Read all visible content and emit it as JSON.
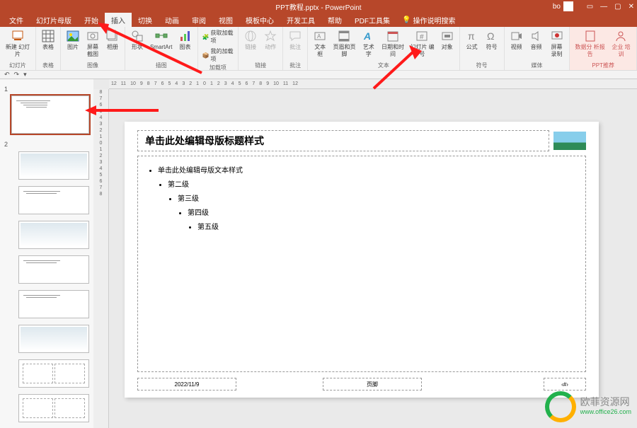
{
  "title": "PPT教程.pptx - PowerPoint",
  "user": "bo",
  "menu": {
    "tabs": [
      "文件",
      "幻灯片母版",
      "开始",
      "插入",
      "切换",
      "动画",
      "审阅",
      "视图",
      "模板中心",
      "开发工具",
      "帮助",
      "PDF工具集"
    ],
    "search_icon_label": "操作说明搜索",
    "active_index": 3
  },
  "ribbon": {
    "slides": {
      "new_slide": "新建\n幻灯片",
      "group": "幻灯片"
    },
    "tables": {
      "table": "表格",
      "group": "表格"
    },
    "images": {
      "picture": "图片",
      "screenshot": "屏幕截图",
      "album": "相册",
      "group": "图像"
    },
    "illustrations": {
      "shapes": "形状",
      "smartart": "SmartArt",
      "chart": "图表",
      "group": "插图"
    },
    "addins": {
      "get": "获取加载项",
      "my": "我的加载项",
      "group": "加载项"
    },
    "links": {
      "link": "链接",
      "action": "动作",
      "group": "链接"
    },
    "comments": {
      "comment": "批注",
      "group": "批注"
    },
    "text": {
      "textbox": "文本框",
      "header_footer": "页眉和页脚",
      "wordart": "艺术字",
      "datetime": "日期和时间",
      "slide_number": "幻灯片\n编号",
      "object": "对象",
      "group": "文本"
    },
    "symbols": {
      "equation": "公式",
      "symbol": "符号",
      "group": "符号"
    },
    "media": {
      "video": "视频",
      "audio": "音频",
      "screen_rec": "屏幕\n录制",
      "group": "媒体"
    },
    "recommend": {
      "data_report": "数据分\n析报告",
      "training": "企业\n培训",
      "group": "PPT推荐"
    }
  },
  "ruler_h": [
    "12",
    "11",
    "10",
    "9",
    "8",
    "7",
    "6",
    "5",
    "4",
    "3",
    "2",
    "1",
    "0",
    "1",
    "2",
    "3",
    "4",
    "5",
    "6",
    "7",
    "8",
    "9",
    "10",
    "11",
    "12"
  ],
  "ruler_v": [
    "8",
    "7",
    "6",
    "5",
    "4",
    "3",
    "2",
    "1",
    "0",
    "1",
    "2",
    "3",
    "4",
    "5",
    "6",
    "7",
    "8"
  ],
  "thumb_nums": [
    "1",
    "2"
  ],
  "slide": {
    "title_ph": "单击此处编辑母版标题样式",
    "body_l1": "单击此处编辑母版文本样式",
    "body_l2": "第二级",
    "body_l3": "第三级",
    "body_l4": "第四级",
    "body_l5": "第五级",
    "date": "2022/11/9",
    "footer": "页脚",
    "num": "‹#›"
  },
  "watermark": {
    "name": "欧菲资源网",
    "url": "www.office26.com"
  }
}
